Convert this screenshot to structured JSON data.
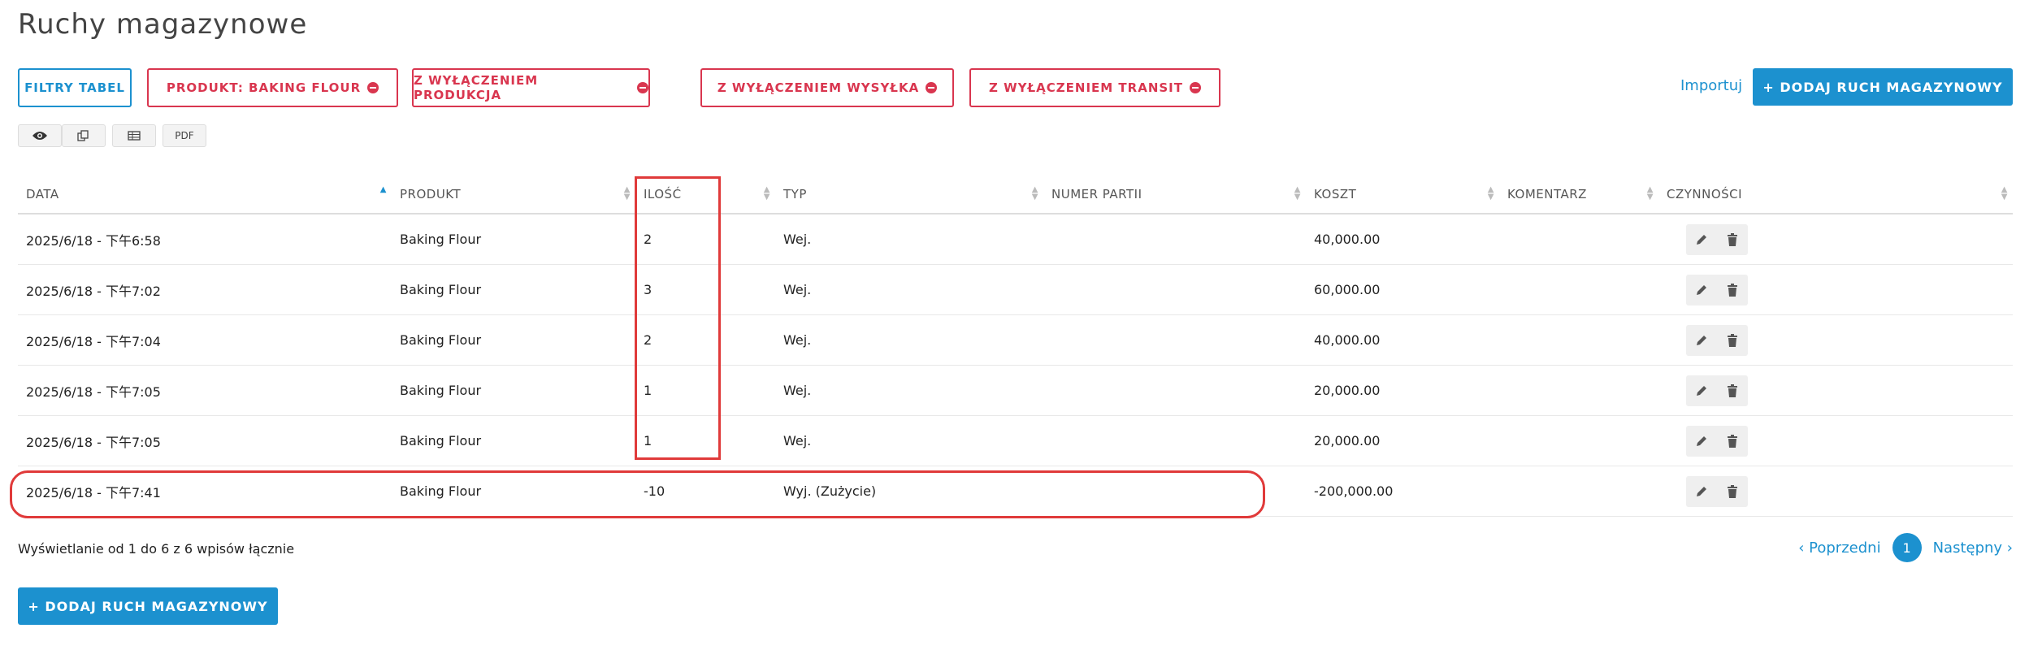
{
  "page": {
    "title": "Ruchy magazynowe"
  },
  "filters": {
    "table_filters": "FILTRY TABEL",
    "product": "PRODUKT: BAKING FLOUR",
    "exclude_production": "Z WYŁĄCZENIEM PRODUKCJA",
    "exclude_shipping": "Z WYŁĄCZENIEM WYSYŁKA",
    "exclude_transit": "Z WYŁĄCZENIEM TRANSIT"
  },
  "actions": {
    "import": "Importuj",
    "add_top": "+ DODAJ RUCH MAGAZYNOWY",
    "add_bottom": "+ DODAJ RUCH MAGAZYNOWY"
  },
  "toolbar": {
    "pdf": "PDF"
  },
  "table": {
    "headers": {
      "date": "DATA",
      "product": "PRODUKT",
      "qty": "ILOŚĆ",
      "type": "TYP",
      "batch": "NUMER PARTII",
      "cost": "KOSZT",
      "comment": "KOMENTARZ",
      "actions": "CZYNNOŚCI"
    },
    "rows": [
      {
        "date": "2025/6/18 - 下午6:58",
        "product": "Baking Flour",
        "qty": "2",
        "type": "Wej.",
        "batch": "",
        "cost": "40,000.00",
        "comment": ""
      },
      {
        "date": "2025/6/18 - 下午7:02",
        "product": "Baking Flour",
        "qty": "3",
        "type": "Wej.",
        "batch": "",
        "cost": "60,000.00",
        "comment": ""
      },
      {
        "date": "2025/6/18 - 下午7:04",
        "product": "Baking Flour",
        "qty": "2",
        "type": "Wej.",
        "batch": "",
        "cost": "40,000.00",
        "comment": ""
      },
      {
        "date": "2025/6/18 - 下午7:05",
        "product": "Baking Flour",
        "qty": "1",
        "type": "Wej.",
        "batch": "",
        "cost": "20,000.00",
        "comment": ""
      },
      {
        "date": "2025/6/18 - 下午7:05",
        "product": "Baking Flour",
        "qty": "1",
        "type": "Wej.",
        "batch": "",
        "cost": "20,000.00",
        "comment": ""
      },
      {
        "date": "2025/6/18 - 下午7:41",
        "product": "Baking Flour",
        "qty": "-10",
        "type": "Wyj. (Zużycie)",
        "batch": "",
        "cost": "-200,000.00",
        "comment": ""
      }
    ]
  },
  "footer": {
    "info": "Wyświetlanie od 1 do 6 z 6 wpisów łącznie",
    "prev": "‹ Poprzedni",
    "page": "1",
    "next": "Następny ›"
  },
  "colors": {
    "accent": "#1c91cf",
    "danger": "#d9364f",
    "highlight": "#e03a3a"
  }
}
